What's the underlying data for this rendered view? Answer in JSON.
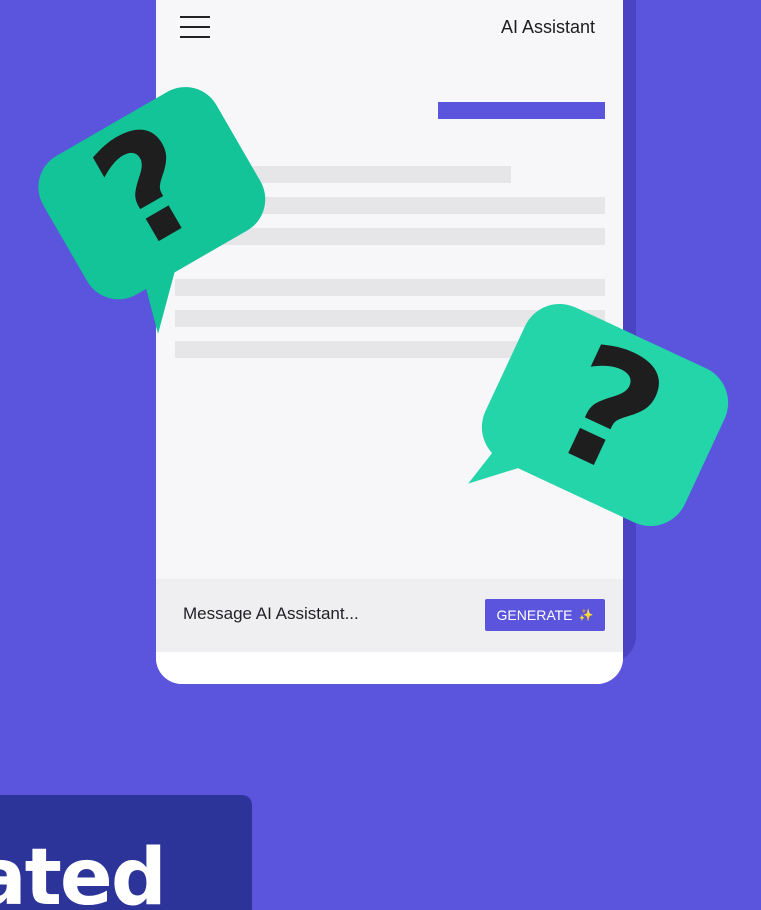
{
  "app": {
    "title": "AI Assistant",
    "menu_icon": "hamburger-menu-icon"
  },
  "composer": {
    "placeholder": "Message AI Assistant...",
    "generate_label": "GENERATE",
    "generate_icon": "✨"
  },
  "decorations": {
    "question_mark": "?",
    "bubble_color_left": "#12c497",
    "bubble_color_right": "#23d5a8"
  },
  "headline": {
    "text": "ated"
  },
  "colors": {
    "background": "#5b55dd",
    "accent": "#5b55dd",
    "headline_card": "#2c349a"
  }
}
